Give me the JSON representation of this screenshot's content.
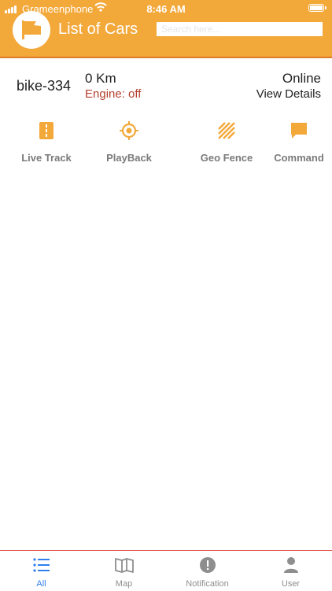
{
  "status_bar": {
    "carrier": "Grameenphone",
    "time": "8:46 AM"
  },
  "header": {
    "title": "List of Cars",
    "search_placeholder": "Search here..."
  },
  "vehicle": {
    "name": "bike-334",
    "distance": "0 Km",
    "engine_status": "Engine: off",
    "connection_status": "Online",
    "details_link": "View Details"
  },
  "actions": [
    {
      "label": "Live Track",
      "icon": "road-icon"
    },
    {
      "label": "PlayBack",
      "icon": "crosshair-icon"
    },
    {
      "label": "Geo Fence",
      "icon": "hatch-icon"
    },
    {
      "label": "Command",
      "icon": "chat-icon"
    }
  ],
  "tabs": [
    {
      "label": "All",
      "icon": "list-icon",
      "active": true
    },
    {
      "label": "Map",
      "icon": "map-icon",
      "active": false
    },
    {
      "label": "Notification",
      "icon": "alert-icon",
      "active": false
    },
    {
      "label": "User",
      "icon": "user-icon",
      "active": false
    }
  ],
  "colors": {
    "accent": "#f3a83a",
    "engine_off": "#b5402d",
    "tab_active": "#2f80ed",
    "divider": "#e2574c"
  }
}
